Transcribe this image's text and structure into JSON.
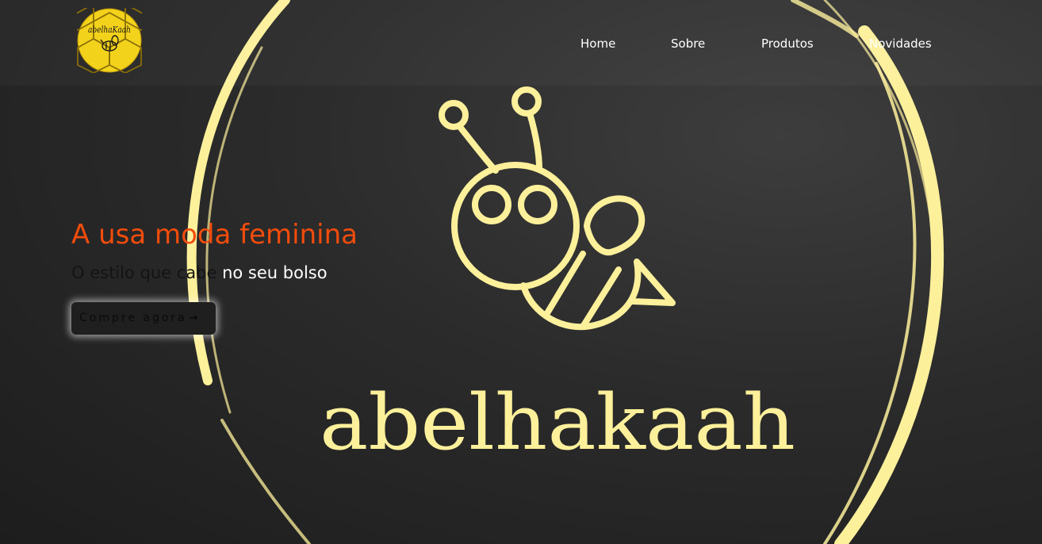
{
  "brand": {
    "logo_text": "abelhaKaah",
    "watermark_text": "abelhakaah"
  },
  "nav": {
    "items": [
      {
        "label": "Home"
      },
      {
        "label": "Sobre"
      },
      {
        "label": "Produtos"
      },
      {
        "label": "Novidades"
      }
    ]
  },
  "hero": {
    "title": "A usa moda feminina",
    "subtitle_part1": "O estilo que cabe",
    "subtitle_part2": " no seu bolso",
    "cta_label": "Compre agora",
    "cta_icon": "arrow-right-icon"
  },
  "colors": {
    "accent": "#f24c0c",
    "gold": "#fdf09b",
    "background": "#2b2b2b",
    "logo_yellow": "#f3d21c"
  }
}
